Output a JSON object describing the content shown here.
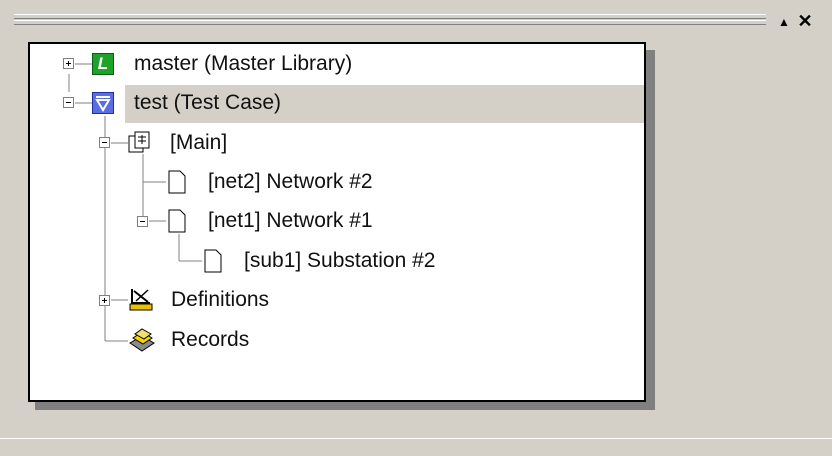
{
  "tree": {
    "nodes": [
      {
        "label": "master (Master Library)",
        "icon": "library-icon",
        "expander": "plus"
      },
      {
        "label": "test (Test Case)",
        "icon": "test-case-icon",
        "expander": "minus",
        "selected": true
      },
      {
        "label": "[Main]",
        "icon": "main-module-icon",
        "expander": "minus"
      },
      {
        "label": "[net2] Network #2",
        "icon": "document-icon"
      },
      {
        "label": "[net1] Network #1",
        "icon": "document-icon",
        "expander": "minus"
      },
      {
        "label": "[sub1] Substation #2",
        "icon": "document-icon"
      },
      {
        "label": "Definitions",
        "icon": "definitions-icon",
        "expander": "plus"
      },
      {
        "label": "Records",
        "icon": "records-icon"
      }
    ]
  },
  "library_icon_letter": "L",
  "colors": {
    "selection": "#d4d0c8",
    "library_green": "#1ea32a",
    "test_case_blue": "#5b6de3"
  },
  "titlebar": {
    "pin_glyph": "▲",
    "close_glyph": "✕"
  }
}
